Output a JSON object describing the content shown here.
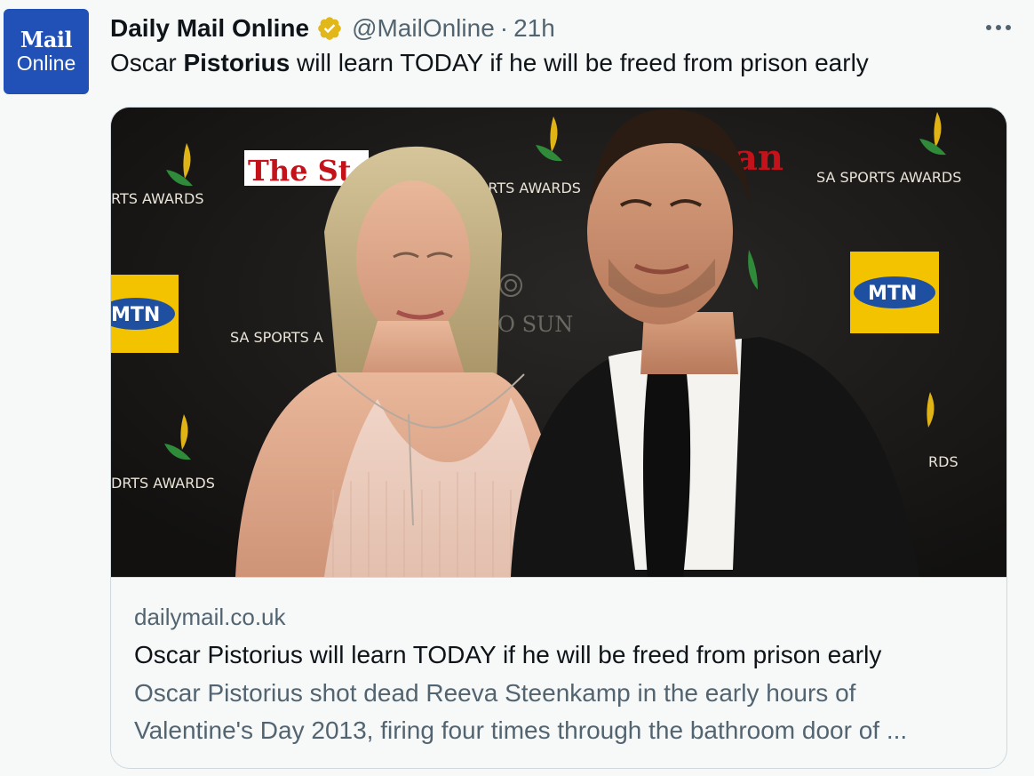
{
  "avatar": {
    "logo_top": "Mail",
    "logo_bottom": "Online"
  },
  "author": {
    "name": "Daily Mail Online",
    "handle": "@MailOnline",
    "separator": "·",
    "time": "21h",
    "verified_icon": "verified-gold-badge-icon"
  },
  "tweet": {
    "text_prefix": "Oscar ",
    "text_bold": "Pistorius",
    "text_suffix": " will learn TODAY if he will be freed from prison early"
  },
  "card": {
    "domain": "dailymail.co.uk",
    "title": "Oscar Pistorius will learn TODAY if he will be freed from prison early",
    "description_line1": "Oscar Pistorius shot dead Reeva Steenkamp in the early hours of",
    "description_line2": "Valentine's Day 2013, firing four times through the bathroom door of ..."
  },
  "photo_backdrop": {
    "sponsor_sa_sports": "SA SPORTS AWARDS",
    "sponsor_sa_sports_cut1": "RTS AWARDS",
    "sponsor_sa_sports_cut2": "SPORTS AWARDS",
    "sponsor_sa_sports_cut3": "SA SPORTS A",
    "sponsor_sa_sports_cut4": "DRTS AWARDS",
    "sponsor_sa_sports_cut5": "RDS",
    "sponsor_mtn": "MTN",
    "sponsor_star": "The St",
    "sponsor_an": "an",
    "sponsor_sun": "SOGO SUN"
  },
  "colors": {
    "avatar_bg": "#2150b7",
    "verified_gold": "#e2b719",
    "secondary_text": "#536471",
    "border": "#cfd9de",
    "mtn_yellow": "#f4c300"
  }
}
